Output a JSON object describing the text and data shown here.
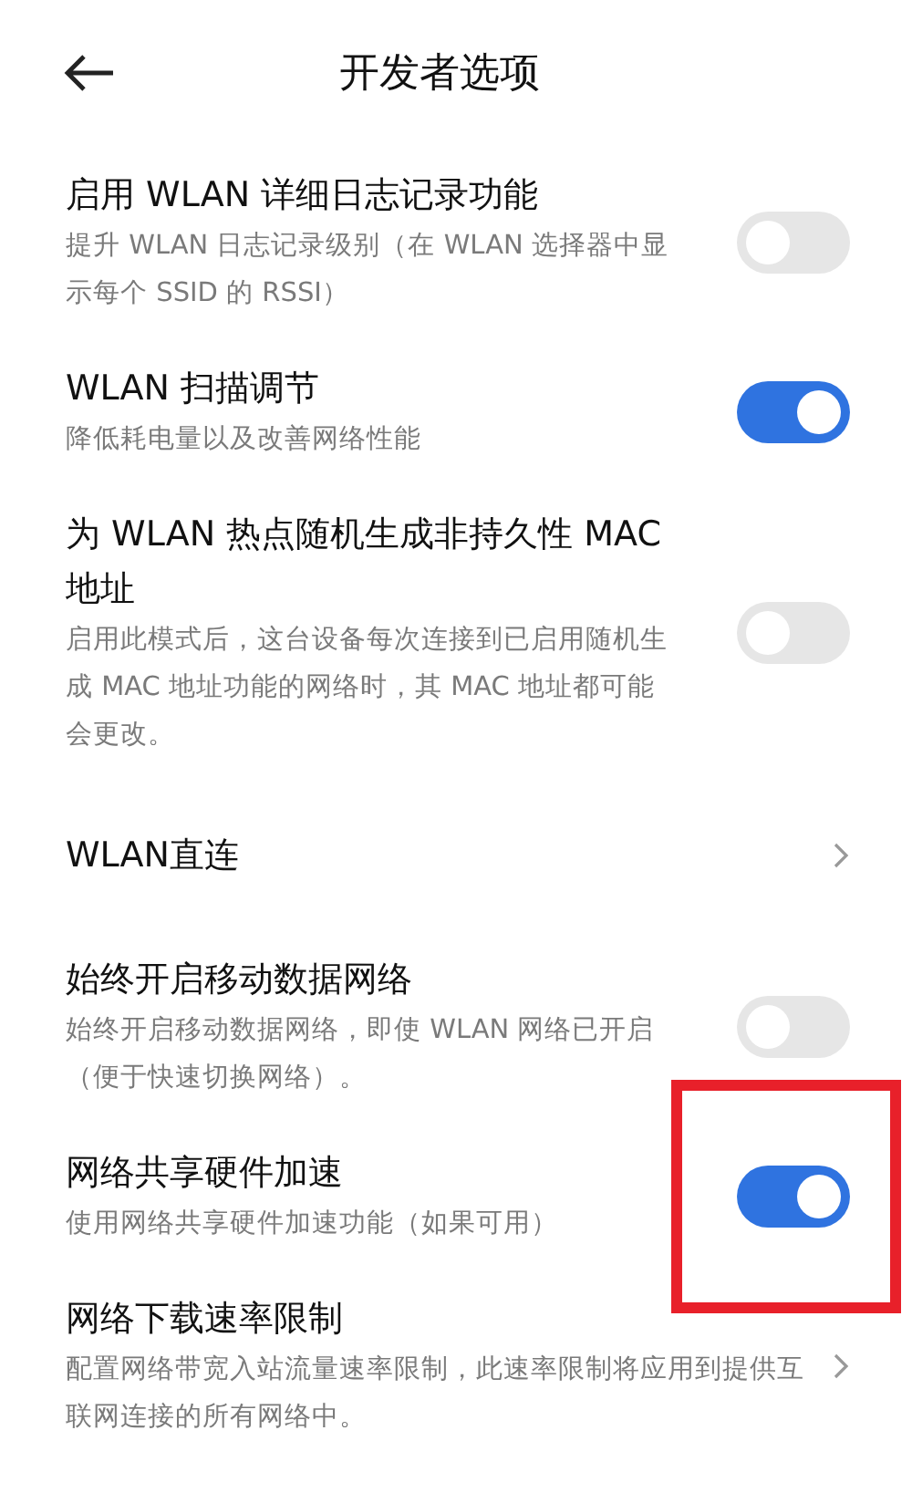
{
  "header": {
    "title": "开发者选项"
  },
  "items": [
    {
      "kind": "toggle",
      "title": "启用 WLAN 详细日志记录功能",
      "subtitle": "提升 WLAN 日志记录级别（在 WLAN 选择器中显示每个 SSID 的 RSSI）",
      "on": false,
      "highlighted": false
    },
    {
      "kind": "toggle",
      "title": "WLAN 扫描调节",
      "subtitle": "降低耗电量以及改善网络性能",
      "on": true,
      "highlighted": false
    },
    {
      "kind": "toggle",
      "title": "为 WLAN 热点随机生成非持久性 MAC 地址",
      "subtitle": "启用此模式后，这台设备每次连接到已启用随机生成 MAC 地址功能的网络时，其 MAC 地址都可能会更改。",
      "on": false,
      "highlighted": false
    },
    {
      "kind": "link",
      "title": "WLAN直连"
    },
    {
      "kind": "toggle",
      "title": "始终开启移动数据网络",
      "subtitle": "始终开启移动数据网络，即使 WLAN 网络已开启（便于快速切换网络）。",
      "on": false,
      "highlighted": false
    },
    {
      "kind": "toggle",
      "title": "网络共享硬件加速",
      "subtitle": "使用网络共享硬件加速功能（如果可用）",
      "on": true,
      "highlighted": true
    },
    {
      "kind": "link",
      "title": "网络下载速率限制",
      "subtitle": "配置网络带宽入站流量速率限制，此速率限制将应用到提供互联网连接的所有网络中。"
    }
  ]
}
